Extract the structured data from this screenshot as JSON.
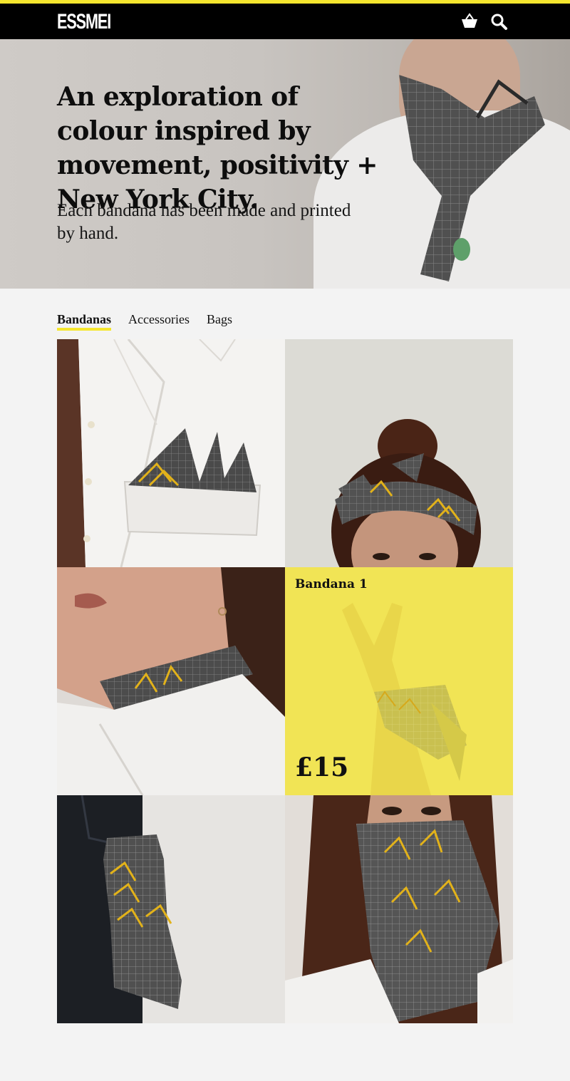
{
  "brand": {
    "logo_text": "ESSMEI",
    "accent_color": "#f5e62e"
  },
  "header": {
    "icons": [
      "basket-icon",
      "search-icon"
    ]
  },
  "hero": {
    "headline": "An exploration of colour inspired by movement, positivity + New York City.",
    "subtext": "Each bandana has been made and printed by hand."
  },
  "tabs": [
    {
      "label": "Bandanas",
      "active": true
    },
    {
      "label": "Accessories",
      "active": false
    },
    {
      "label": "Bags",
      "active": false
    }
  ],
  "products": [
    {
      "image": "pocket-square-shirt-photo"
    },
    {
      "image": "headband-photo"
    },
    {
      "image": "neck-bandana-photo"
    },
    {
      "image": "wrist-bandana-photo",
      "name": "Bandana 1",
      "price": "£15",
      "highlighted": true
    },
    {
      "image": "pocket-bandana-jeans-photo"
    },
    {
      "image": "face-mask-bandana-photo"
    }
  ]
}
